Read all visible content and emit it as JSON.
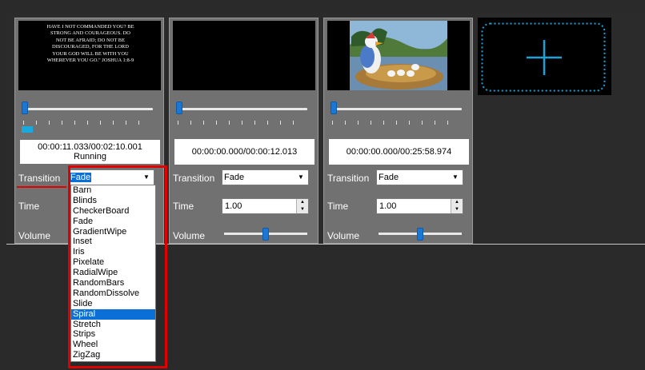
{
  "panels": [
    {
      "verse": "HAVE I NOT COMMANDED YOU? BE STRONG AND COURAGEOUS. DO NOT BE AFRAID; DO NOT BE DISCOURAGED, FOR THE LORD YOUR GOD WILL BE WITH YOU WHEREVER YOU GO.\" JOSHUA 1:8-9",
      "time": "00:00:11.033/00:02:10.001",
      "status": "Running",
      "transition_label": "Transition",
      "transition_value": "Fade",
      "time_label": "Time",
      "time_value": "",
      "volume_label": "Volume"
    },
    {
      "time": "00:00:00.000/00:00:12.013",
      "transition_label": "Transition",
      "transition_value": "Fade",
      "time_label": "Time",
      "time_value": "1.00",
      "volume_label": "Volume"
    },
    {
      "time": "00:00:00.000/00:25:58.974",
      "transition_label": "Transition",
      "transition_value": "Fade",
      "time_label": "Time",
      "time_value": "1.00",
      "volume_label": "Volume"
    }
  ],
  "dropdown": {
    "options": [
      "Barn",
      "Blinds",
      "CheckerBoard",
      "Fade",
      "GradientWipe",
      "Inset",
      "Iris",
      "Pixelate",
      "RadialWipe",
      "RandomBars",
      "RandomDissolve",
      "Slide",
      "Spiral",
      "Stretch",
      "Strips",
      "Wheel",
      "ZigZag"
    ],
    "selected": "Spiral"
  },
  "colors": {
    "accent": "#1a78d4",
    "highlight": "#e00000",
    "add_icon": "#1ea0d8"
  }
}
